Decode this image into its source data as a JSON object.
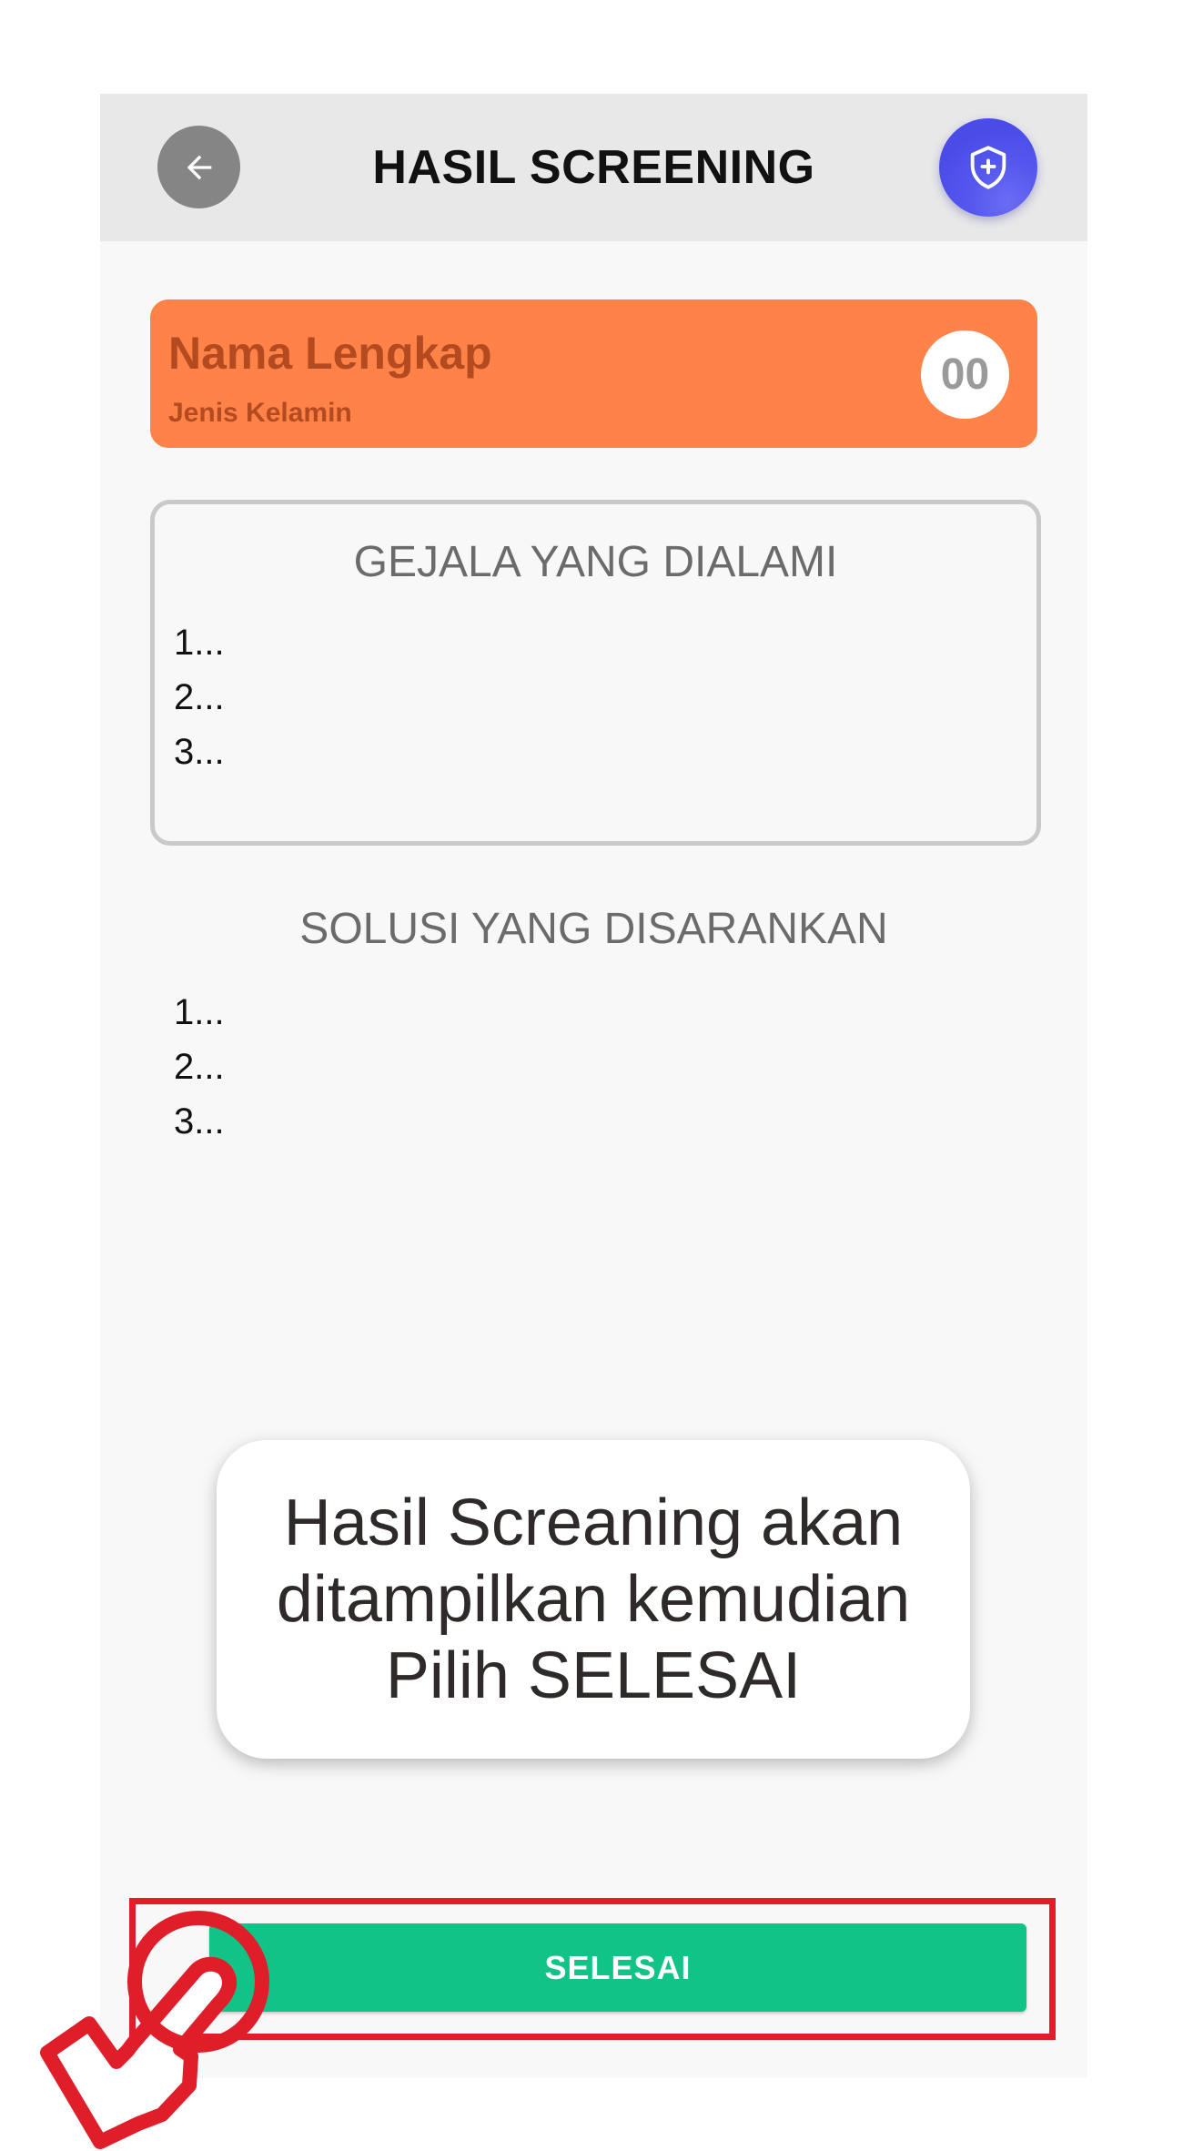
{
  "header": {
    "title": "HASIL SCREENING",
    "back_icon": "arrow-left-icon",
    "action_icon": "shield-plus-icon",
    "bar_color": "#e8e8e8",
    "action_color": "#4a4ce8"
  },
  "profile": {
    "name": "Nama Lengkap",
    "gender": "Jenis Kelamin",
    "badge": "00",
    "card_color": "#ff8248"
  },
  "symptoms": {
    "title": "GEJALA YANG DIALAMI",
    "items": [
      "1...",
      "2...",
      "3..."
    ]
  },
  "solutions": {
    "title": "SOLUSI YANG DISARANKAN",
    "items": [
      "1...",
      "2...",
      "3..."
    ]
  },
  "tooltip": {
    "lines": [
      "Hasil Screaning akan",
      "ditampilkan kemudian",
      "Pilih SELESAI"
    ]
  },
  "footer": {
    "button_label": "SELESAI",
    "button_color": "#11c386",
    "highlight_color": "#e01e2a",
    "pointer_icon": "hand-pointer-icon"
  }
}
